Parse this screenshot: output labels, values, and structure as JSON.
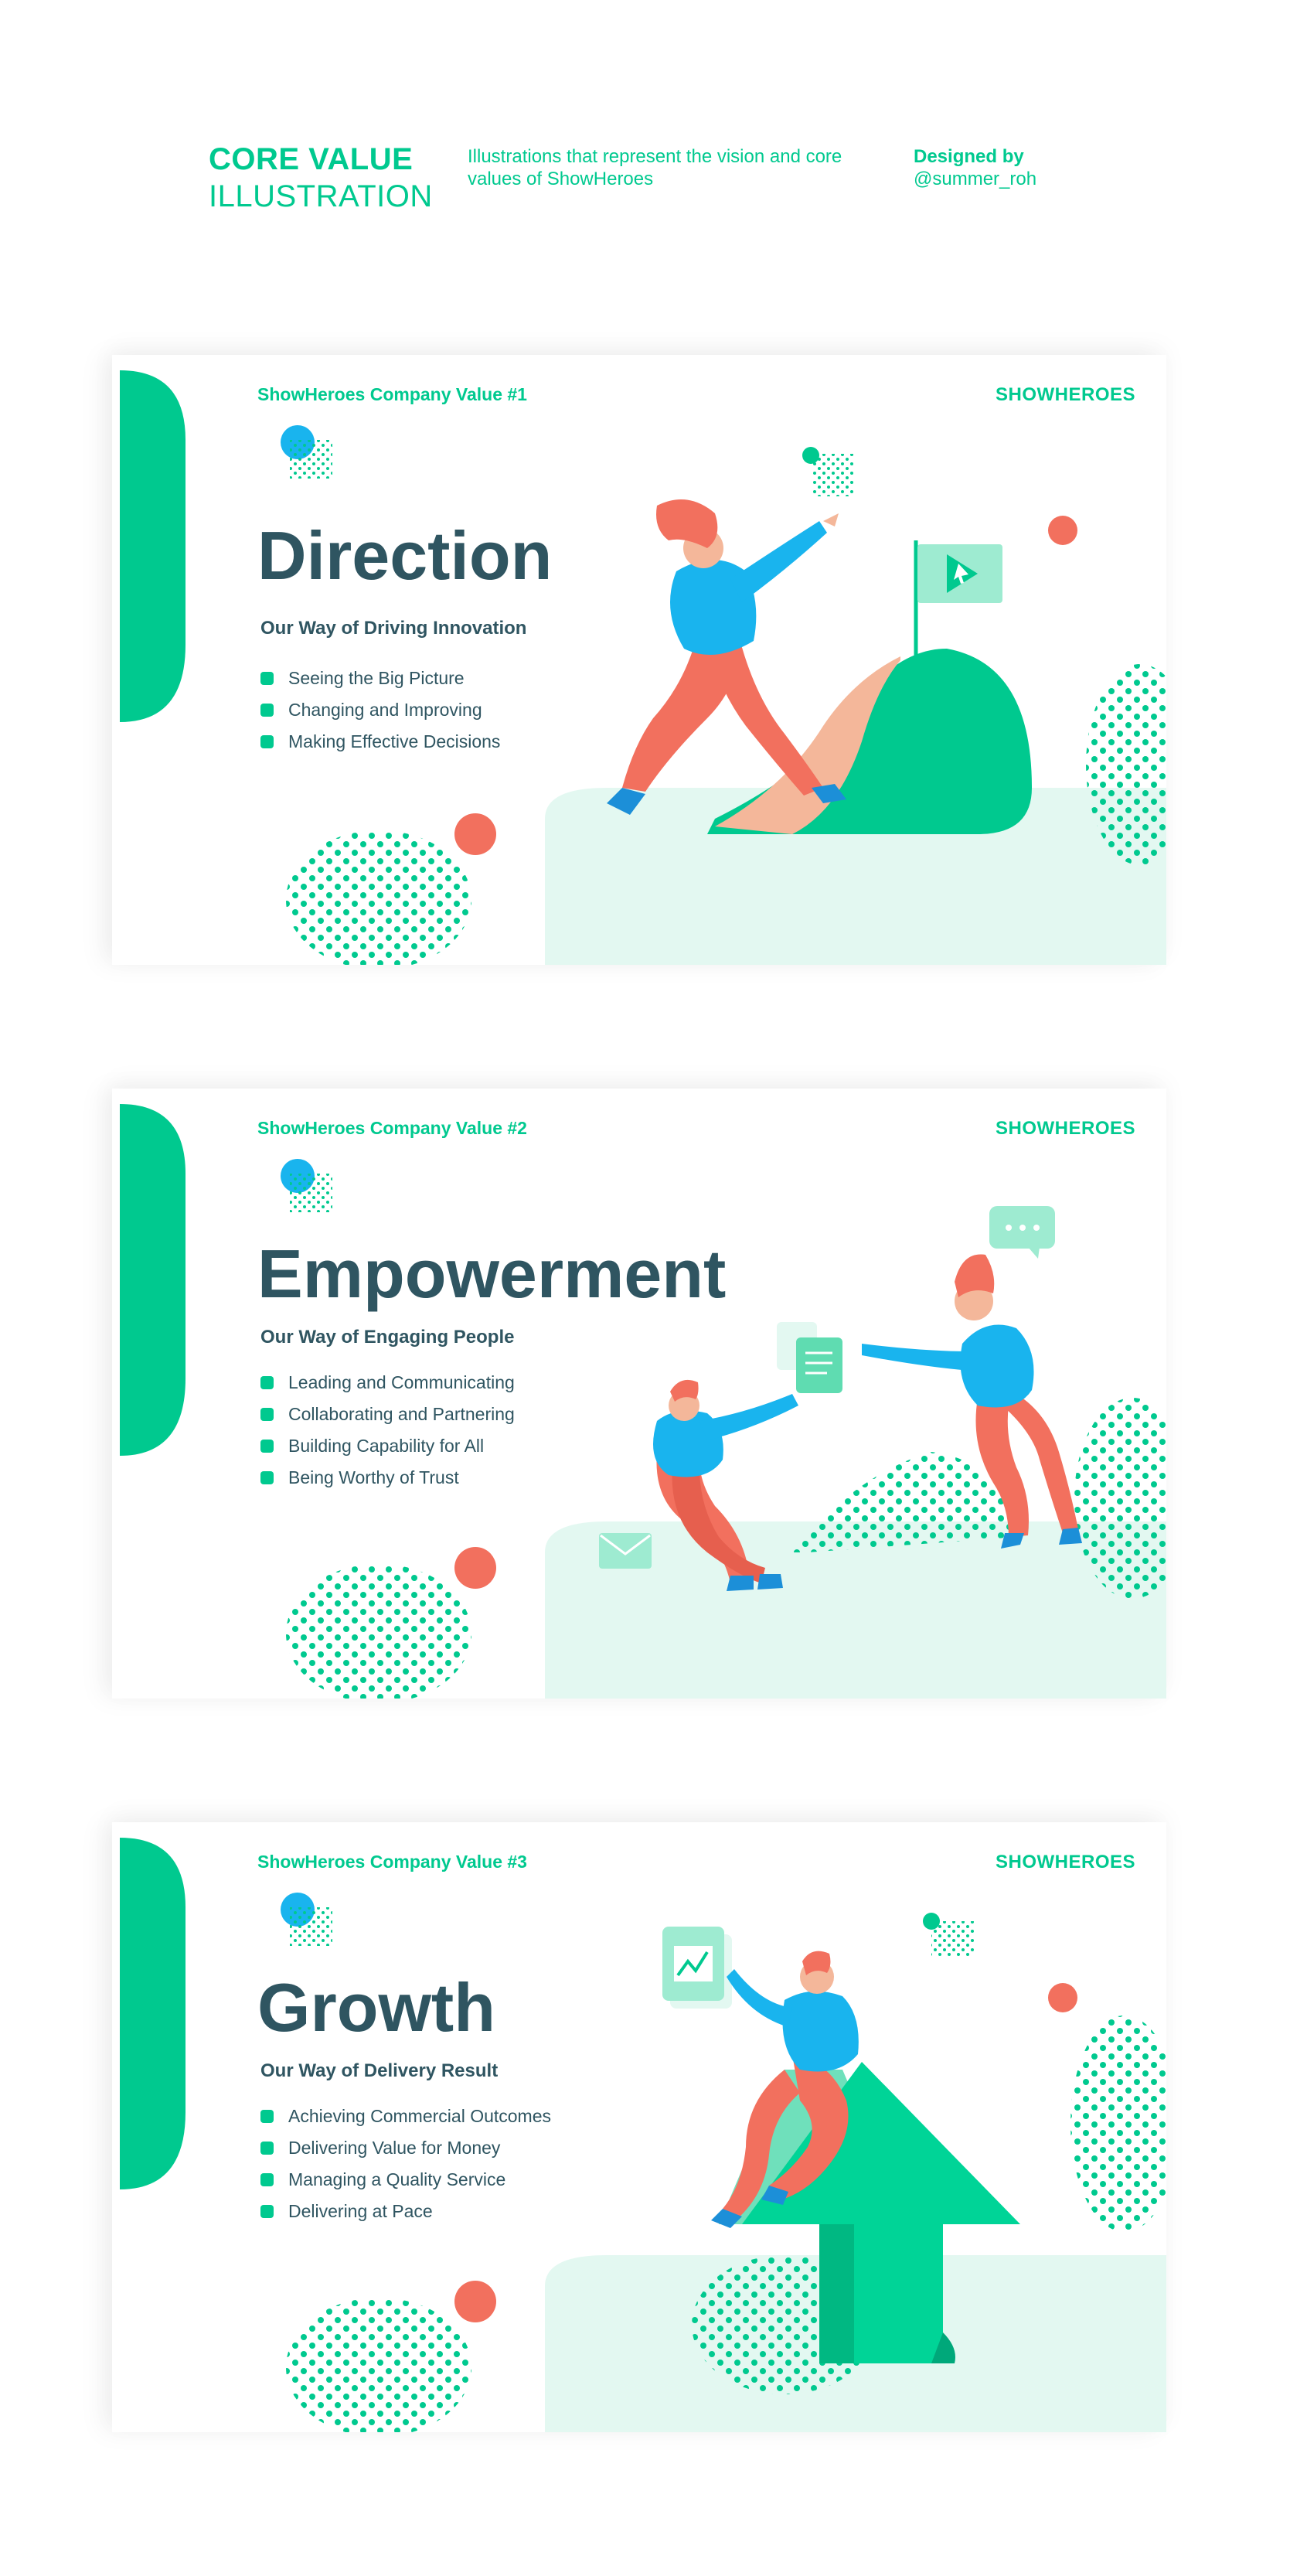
{
  "header": {
    "title_line1": "CORE VALUE",
    "title_line2": "ILLUSTRATION",
    "description": "Illustrations that represent the vision and core values of ShowHeroes",
    "credit_label": "Designed by",
    "credit_handle": "@summer_roh"
  },
  "colors": {
    "accent": "#00c98f",
    "text": "#2f5561",
    "coral": "#f2705e",
    "blue": "#19b4ee",
    "mint": "#e3f8f1"
  },
  "cards": [
    {
      "tag": "ShowHeroes Company Value #1",
      "brand": "SHOWHEROES",
      "title": "Direction",
      "subtitle": "Our Way of Driving Innovation",
      "items": [
        "Seeing the Big Picture",
        "Changing and Improving",
        "Making Effective Decisions"
      ]
    },
    {
      "tag": "ShowHeroes Company Value #2",
      "brand": "SHOWHEROES",
      "title": "Empowerment",
      "subtitle": "Our Way of Engaging People",
      "items": [
        "Leading and Communicating",
        "Collaborating and Partnering",
        "Building Capability for All",
        "Being Worthy of Trust"
      ]
    },
    {
      "tag": "ShowHeroes Company Value #3",
      "brand": "SHOWHEROES",
      "title": "Growth",
      "subtitle": "Our Way of Delivery Result",
      "items": [
        "Achieving Commercial Outcomes",
        "Delivering Value for Money",
        "Managing a Quality Service",
        "Delivering at Pace"
      ]
    }
  ]
}
